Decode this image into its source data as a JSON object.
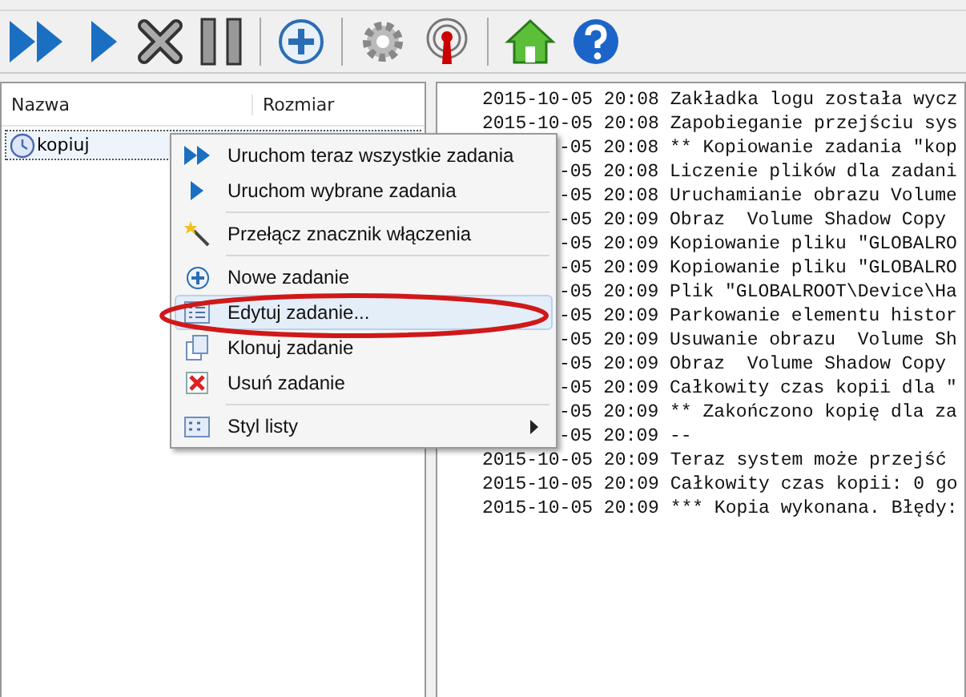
{
  "task_list": {
    "columns": [
      "Nazwa",
      "Rozmiar"
    ],
    "rows": [
      {
        "name": "kopiuj",
        "selected": true
      }
    ]
  },
  "context_menu": {
    "groups": [
      [
        {
          "label": "Uruchom teraz wszystkie zadania",
          "selected": false,
          "has_submenu": false
        },
        {
          "label": "Uruchom wybrane zadania",
          "selected": false,
          "has_submenu": false
        }
      ],
      [
        {
          "label": "Przełącz znacznik włączenia",
          "selected": false,
          "has_submenu": false
        }
      ],
      [
        {
          "label": "Nowe zadanie",
          "selected": false,
          "has_submenu": false
        },
        {
          "label": "Edytuj zadanie...",
          "selected": true,
          "has_submenu": false
        },
        {
          "label": "Klonuj zadanie",
          "selected": false,
          "has_submenu": false
        },
        {
          "label": "Usuń zadanie",
          "selected": false,
          "has_submenu": false
        }
      ],
      [
        {
          "label": "Styl listy",
          "selected": false,
          "has_submenu": true
        }
      ]
    ]
  },
  "log": {
    "lines": [
      {
        "text": "2015-10-05 20:08 Zakładka logu została wycz",
        "covered": false
      },
      {
        "text": "2015-10-05 20:08 Zapobieganie przejściu sys",
        "covered": false
      },
      {
        "text": "-05 20:08 ** Kopiowanie zadania \"kop",
        "covered": true
      },
      {
        "text": "-05 20:08 Liczenie plików dla zadani",
        "covered": true
      },
      {
        "text": "-05 20:08 Uruchamianie obrazu Volume",
        "covered": true
      },
      {
        "text": "-05 20:09 Obraz  Volume Shadow Copy",
        "covered": true
      },
      {
        "text": "-05 20:09 Kopiowanie pliku \"GLOBALRO",
        "covered": true
      },
      {
        "text": "-05 20:09 Kopiowanie pliku \"GLOBALRO",
        "covered": true
      },
      {
        "text": "-05 20:09 Plik \"GLOBALROOT\\Device\\Ha",
        "covered": true
      },
      {
        "text": "-05 20:09 Parkowanie elementu histor",
        "covered": true
      },
      {
        "text": "-05 20:09 Usuwanie obrazu  Volume Sh",
        "covered": true
      },
      {
        "text": "-05 20:09 Obraz  Volume Shadow Copy",
        "covered": true
      },
      {
        "text": "-05 20:09 Całkowity czas kopii dla \"",
        "covered": true
      },
      {
        "text": "-05 20:09 ** Zakończono kopię dla za",
        "covered": true
      },
      {
        "text": "-05 20:09 --",
        "covered": true
      },
      {
        "text": "2015-10-05 20:09 Teraz system może przejść",
        "covered": false
      },
      {
        "text": "2015-10-05 20:09 Całkowity czas kopii: 0 go",
        "covered": false
      },
      {
        "text": "2015-10-05 20:09 *** Kopia wykonana. Błędy:",
        "covered": false
      }
    ]
  }
}
